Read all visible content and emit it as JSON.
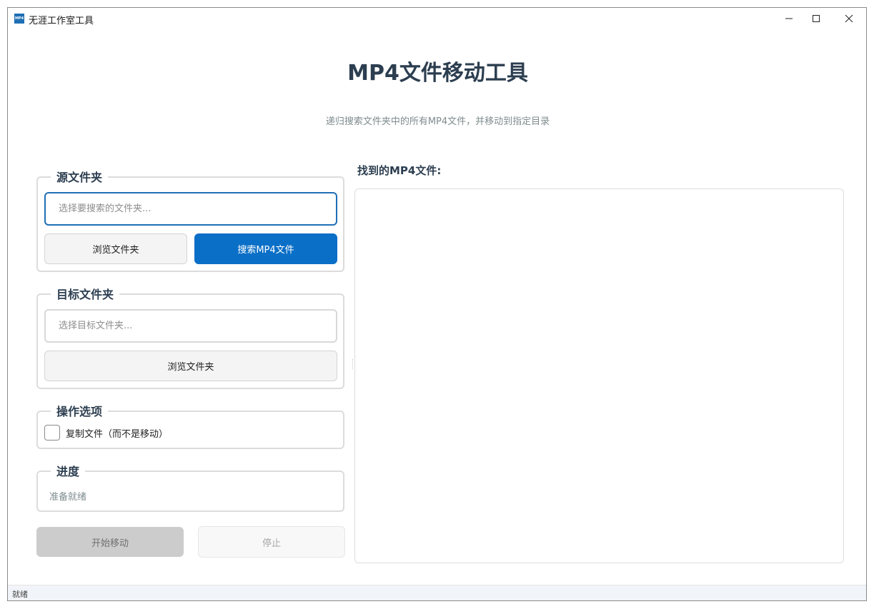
{
  "window": {
    "icon_text": "MP4",
    "title": "无涯工作室工具"
  },
  "header": {
    "title": "MP4文件移动工具",
    "subtitle": "递归搜索文件夹中的所有MP4文件，并移动到指定目录"
  },
  "source": {
    "group_title": "源文件夹",
    "input_value": "",
    "input_placeholder": "选择要搜索的文件夹...",
    "browse_label": "浏览文件夹",
    "search_label": "搜索MP4文件"
  },
  "target": {
    "group_title": "目标文件夹",
    "input_value": "",
    "input_placeholder": "选择目标文件夹...",
    "browse_label": "浏览文件夹"
  },
  "options": {
    "group_title": "操作选项",
    "copy_label": "复制文件（而不是移动）",
    "copy_checked": false
  },
  "progress": {
    "group_title": "进度",
    "status": "准备就绪"
  },
  "actions": {
    "start_label": "开始移动",
    "stop_label": "停止"
  },
  "results": {
    "label": "找到的MP4文件:",
    "files": []
  },
  "statusbar": {
    "text": "就绪"
  },
  "colors": {
    "primary": "#0a6fc7",
    "title_text": "#2c3e50",
    "muted_text": "#7f8c8d"
  }
}
